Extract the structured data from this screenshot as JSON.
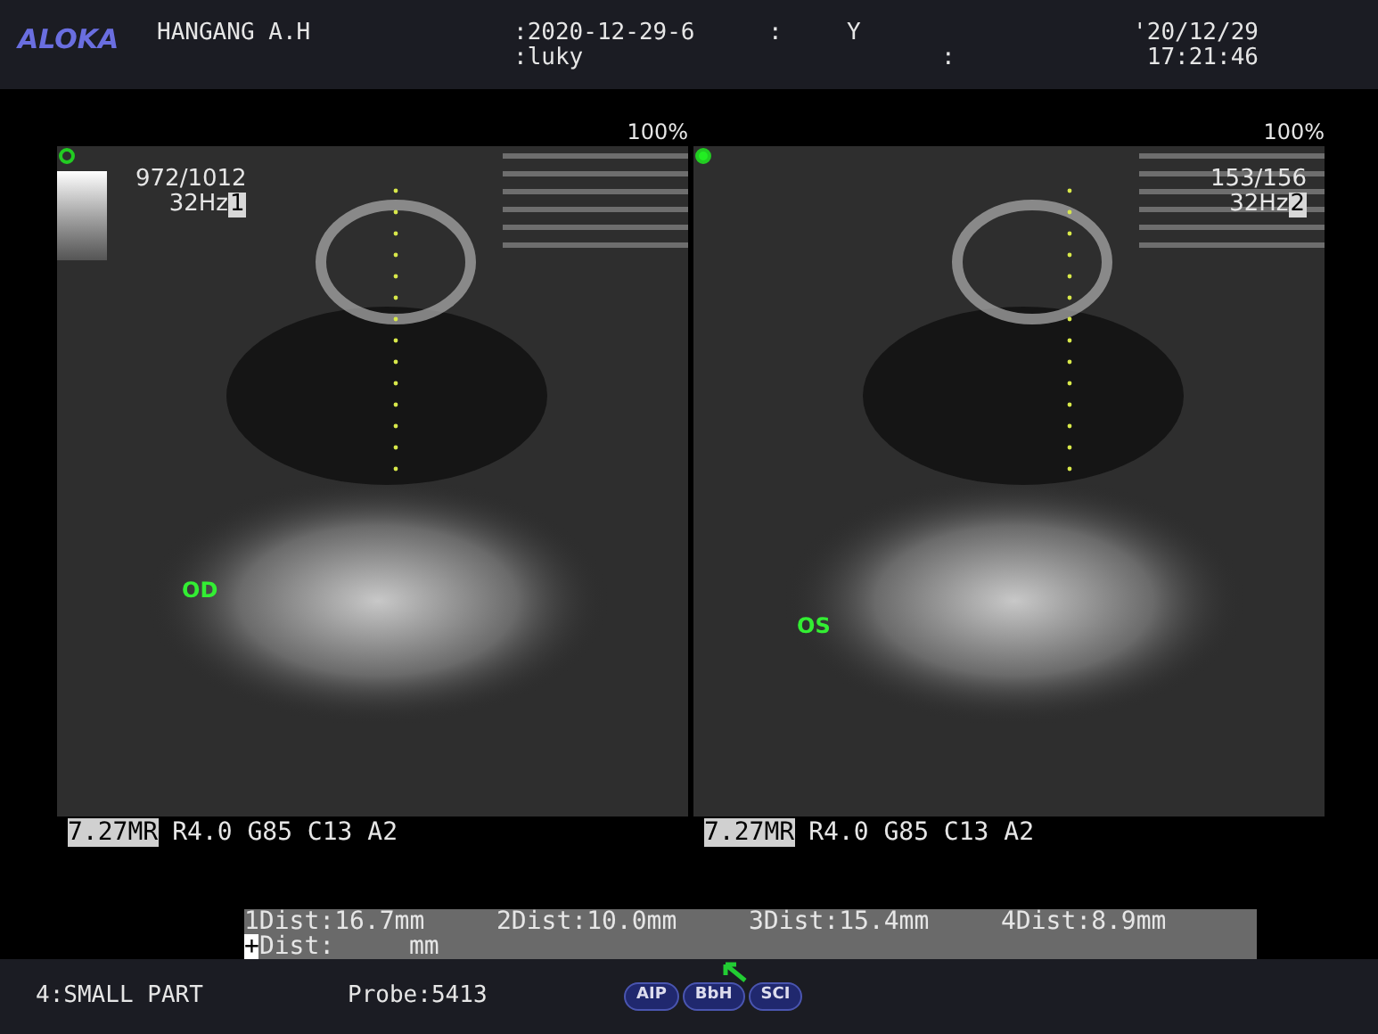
{
  "header": {
    "logo": "ALOKA",
    "patient_name": "HANGANG A.H",
    "patient_id": ":2020-12-29-6",
    "separator": ":",
    "sex": "Y",
    "comment": ":luky",
    "separator_2": ":",
    "date": "'20/12/29",
    "time": "17:21:46"
  },
  "panels": [
    {
      "zoom": "100%",
      "frames": "972/1012",
      "rate": "32Hz",
      "index": "1",
      "label": "OD",
      "active": false,
      "preset": "7.27MR",
      "params": "R4.0 G85 C13 A2"
    },
    {
      "zoom": "100%",
      "frames": "153/156",
      "rate": "32Hz",
      "index": "2",
      "label": "OS",
      "active": true,
      "preset": "7.27MR",
      "params": "R4.0 G85 C13 A2"
    }
  ],
  "measurements": {
    "items": [
      {
        "label": "1Dist:",
        "value": "16.7mm"
      },
      {
        "label": "2Dist:",
        "value": "10.0mm"
      },
      {
        "label": "3Dist:",
        "value": "15.4mm"
      },
      {
        "label": "4Dist:",
        "value": "8.9mm"
      }
    ],
    "next": {
      "marker": "+",
      "label": "Dist:",
      "value": "mm"
    }
  },
  "footer": {
    "mode": "4:SMALL PART",
    "probe": "Probe:5413",
    "buttons": [
      "AIP",
      "BbH",
      "SCI"
    ]
  }
}
